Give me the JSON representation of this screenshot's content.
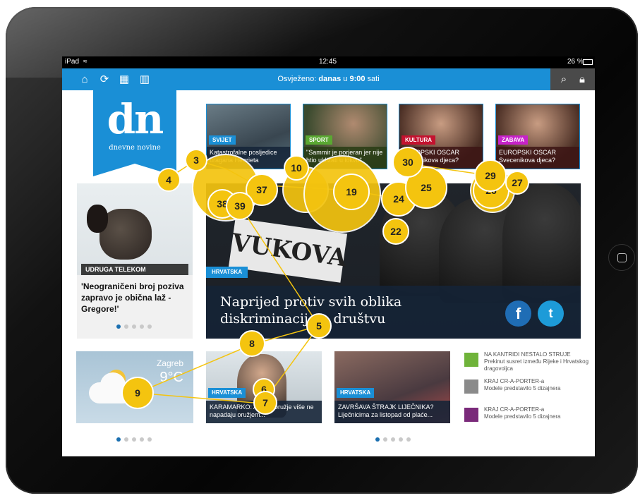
{
  "status_bar": {
    "device": "iPad",
    "time": "12:45",
    "battery": "26 %"
  },
  "app_bar": {
    "refresh_prefix": "Osvježeno:",
    "refresh_day": "danas",
    "refresh_mid": "u",
    "refresh_time": "9:00",
    "refresh_suffix": "sati",
    "icons": [
      "home-icon",
      "refresh-icon",
      "grid-icon",
      "book-icon",
      "search-icon",
      "lock-icon"
    ]
  },
  "logo": {
    "mark": "dn",
    "name": "dnevne novine"
  },
  "top_tiles": [
    {
      "tag": "SVIJET",
      "tag_color": "#1a8fd6",
      "caption": "Katastrofalne posljedice uragana Henrieta"
    },
    {
      "tag": "SPORT",
      "tag_color": "#5aa832",
      "caption": "\"Sammir je porjeran jer nije htio uklizati u lokvu\""
    },
    {
      "tag": "KULTURA",
      "tag_color": "#c4122f",
      "caption": "EUROPSKI OSCAR Svecenikova djeca?"
    },
    {
      "tag": "ZABAVA",
      "tag_color": "#c722c9",
      "caption": "EUROPSKI OSCAR Svecenikova djeca?"
    }
  ],
  "left_article": {
    "tag": "UDRUGA TELEKOM",
    "title": "'Neograničeni broj poziva zapravo je obična laž - Gregore!'"
  },
  "hero": {
    "tag": "HRVATSKA",
    "banner_text": "VUKOVA",
    "title": "Naprijed protiv svih oblika diskriminacije u društvu",
    "facebook": "f",
    "twitter": "t"
  },
  "weather": {
    "city": "Zagreb",
    "temp": "9°C"
  },
  "bottom_tiles": [
    {
      "tag": "HRVATSKA",
      "caption": "KARAMARKO: Ako se oružje više ne napadaju oružjem..."
    },
    {
      "tag": "HRVATSKA",
      "caption": "ZAVRŠAVA ŠTRAJK LIJEČNIKA? Liječnicima za listopad od plaće..."
    }
  ],
  "side_news": [
    {
      "color": "#6fb33a",
      "title": "NA KANTRIDI NESTALO STRUJE",
      "text": "Prekinut susret između Rijeke i Hrvatskog dragovoljca"
    },
    {
      "color": "#8a8a8a",
      "title": "KRAJ CR-A-PORTER-a",
      "text": "Modele predstavilo 5 dizajnera"
    },
    {
      "color": "#7a2a7a",
      "title": "KRAJ CR-A-PORTER-a",
      "text": "Modele predstavilo 5 dizajnera"
    }
  ],
  "heat_markers": [
    "3",
    "4",
    "5",
    "6",
    "7",
    "8",
    "9",
    "10",
    "19",
    "22",
    "24",
    "25",
    "26",
    "27",
    "29",
    "30",
    "37",
    "38",
    "39"
  ]
}
